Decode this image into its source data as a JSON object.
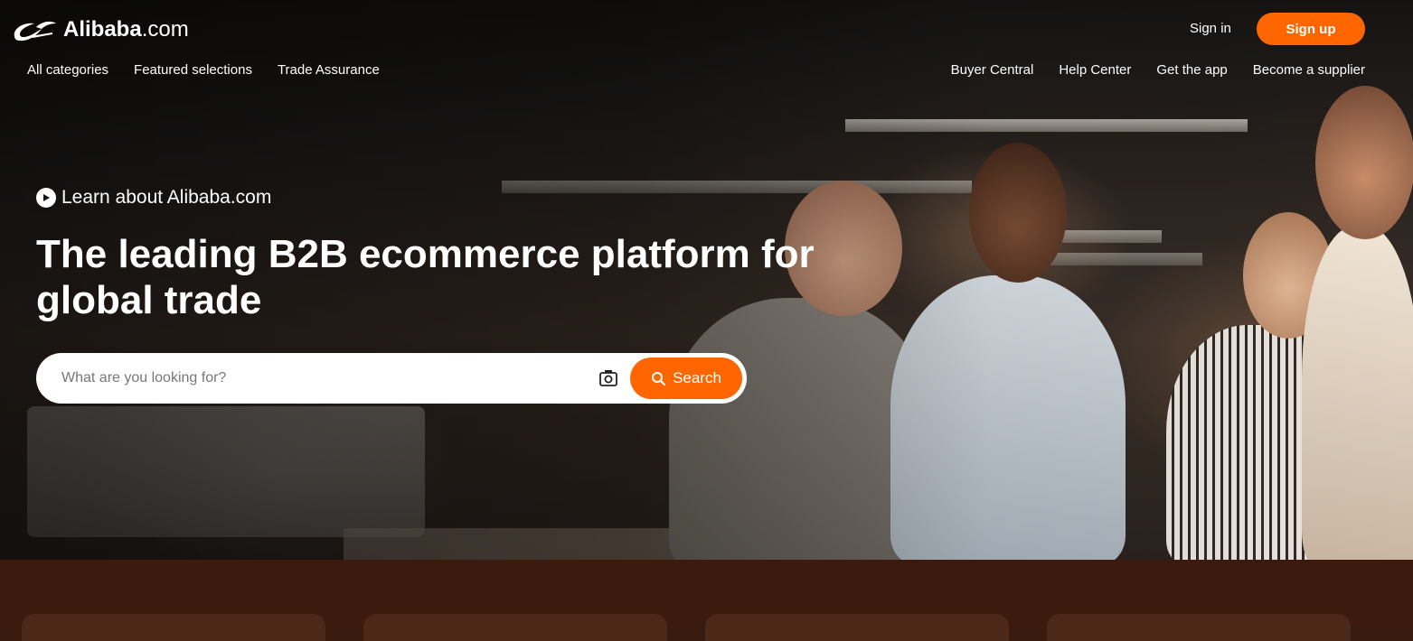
{
  "header": {
    "logo_text": "Alibaba",
    "logo_suffix": ".com",
    "sign_in": "Sign in",
    "sign_up": "Sign up"
  },
  "nav_left": [
    "All categories",
    "Featured selections",
    "Trade Assurance"
  ],
  "nav_right": [
    "Buyer Central",
    "Help Center",
    "Get the app",
    "Become a supplier"
  ],
  "hero": {
    "learn_link": "Learn about Alibaba.com",
    "headline": "The leading B2B ecommerce platform for global trade"
  },
  "search": {
    "placeholder": "What are you looking for?",
    "button_label": "Search"
  },
  "colors": {
    "accent": "#ff6600",
    "bottom_band": "#3c1a0d"
  }
}
